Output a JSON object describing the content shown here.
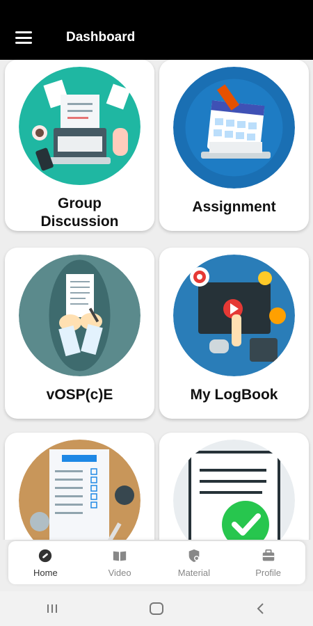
{
  "app_title": "Dashboard",
  "tiles": [
    {
      "label": "Group\nDiscussion",
      "illustration": "laptop-desk-illustration"
    },
    {
      "label": "Assignment",
      "illustration": "calendar-laptop-illustration"
    },
    {
      "label": "vOSP(c)E",
      "illustration": "writing-paper-illustration"
    },
    {
      "label": "My LogBook",
      "illustration": "video-presentation-illustration"
    },
    {
      "label": "",
      "illustration": "test-sheet-illustration"
    },
    {
      "label": "",
      "illustration": "document-check-illustration"
    }
  ],
  "bottom_nav": [
    {
      "label": "Home",
      "icon": "wrench-icon",
      "active": true
    },
    {
      "label": "Video",
      "icon": "book-icon",
      "active": false
    },
    {
      "label": "Material",
      "icon": "shield-icon",
      "active": false
    },
    {
      "label": "Profile",
      "icon": "briefcase-icon",
      "active": false
    }
  ],
  "colors": {
    "appbar": "#000000",
    "teal": "#1fb7a2",
    "blue": "#1a6fb3",
    "slate": "#5b8a8c",
    "nav_active": "#333333",
    "nav_inactive": "#888888",
    "check_green": "#27c64e"
  }
}
